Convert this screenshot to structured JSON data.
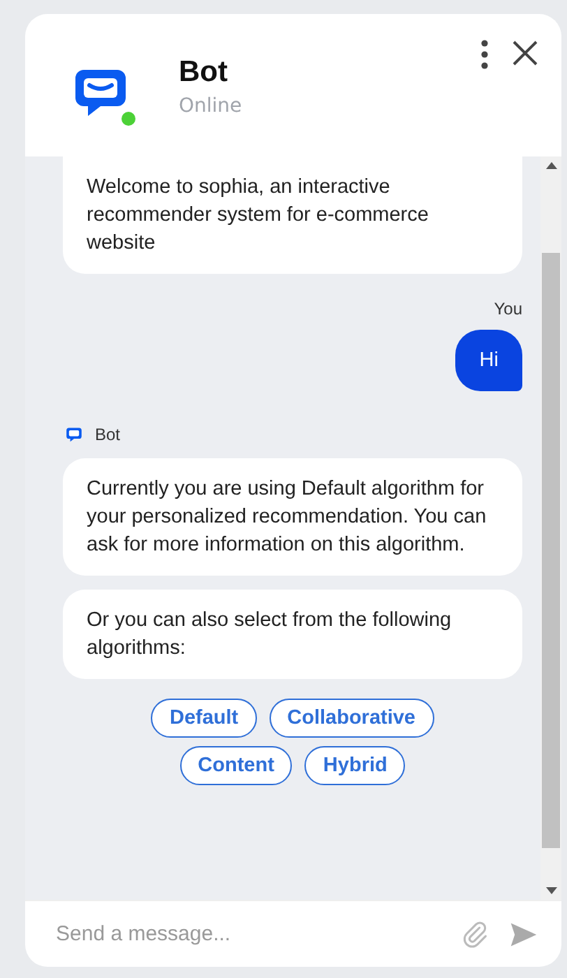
{
  "header": {
    "title": "Bot",
    "status": "Online",
    "online": true
  },
  "messages": [
    {
      "kind": "bot",
      "text": "Welcome to sophia, an interactive recommender system for e-commerce website"
    },
    {
      "kind": "author",
      "text": "You"
    },
    {
      "kind": "user",
      "text": "Hi"
    },
    {
      "kind": "bot-author",
      "text": "Bot"
    },
    {
      "kind": "bot",
      "text": "Currently you are using Default algorithm for your personalized recommendation. You can ask for more information on this algorithm."
    },
    {
      "kind": "bot",
      "text": "Or you can also select from the following algorithms:"
    }
  ],
  "quick_replies": [
    {
      "label": "Default"
    },
    {
      "label": "Collaborative"
    },
    {
      "label": "Content"
    },
    {
      "label": "Hybrid"
    }
  ],
  "composer": {
    "placeholder": "Send a message..."
  }
}
